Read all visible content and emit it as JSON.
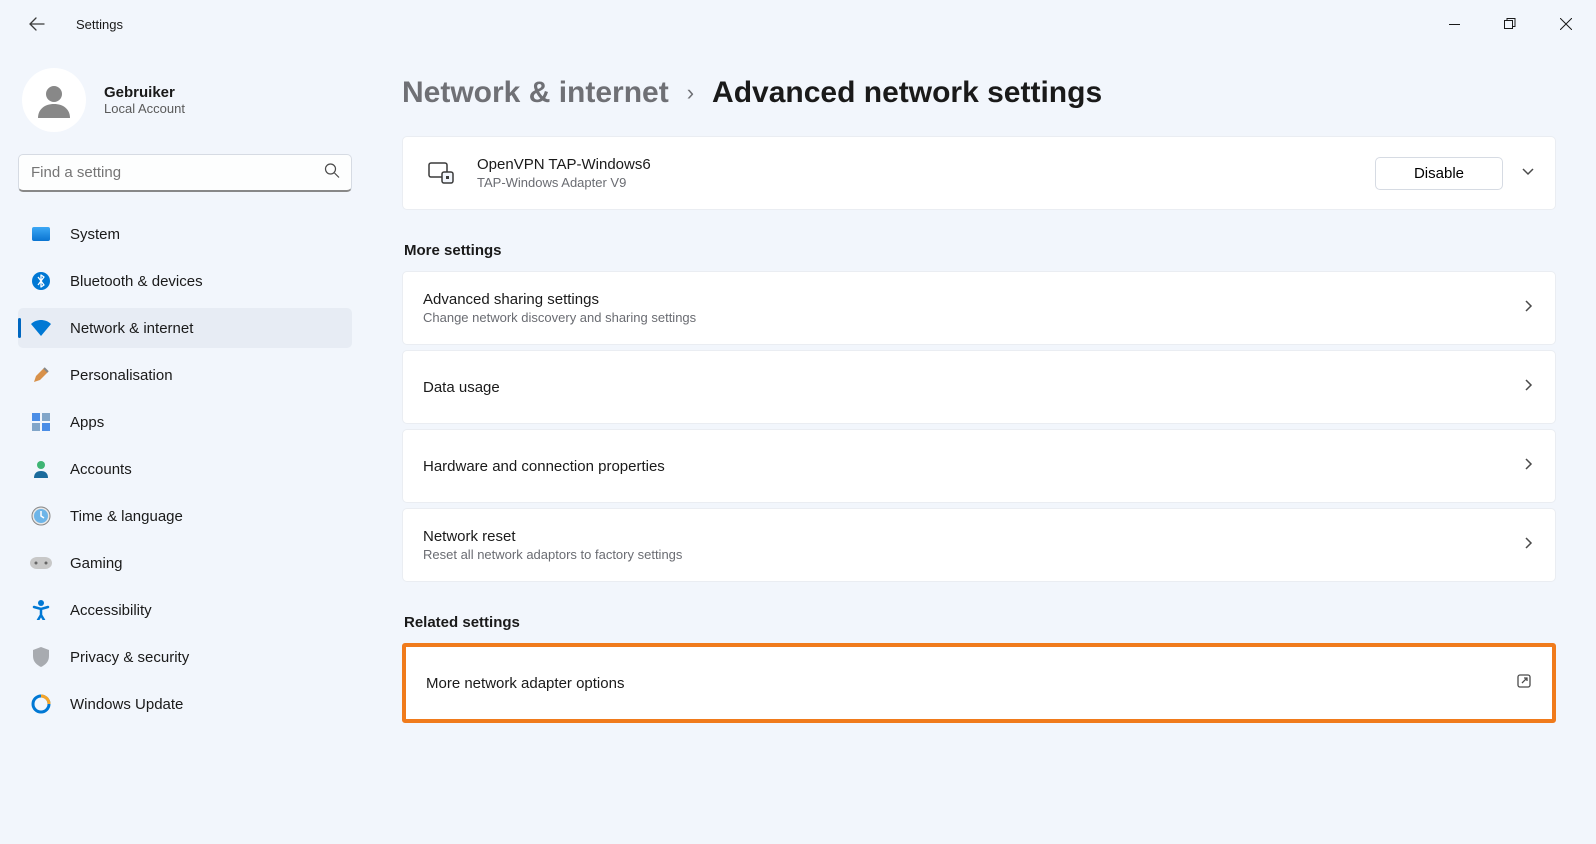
{
  "app": {
    "title": "Settings"
  },
  "user": {
    "name": "Gebruiker",
    "subtitle": "Local Account"
  },
  "search": {
    "placeholder": "Find a setting"
  },
  "nav": [
    {
      "label": "System"
    },
    {
      "label": "Bluetooth & devices"
    },
    {
      "label": "Network & internet"
    },
    {
      "label": "Personalisation"
    },
    {
      "label": "Apps"
    },
    {
      "label": "Accounts"
    },
    {
      "label": "Time & language"
    },
    {
      "label": "Gaming"
    },
    {
      "label": "Accessibility"
    },
    {
      "label": "Privacy & security"
    },
    {
      "label": "Windows Update"
    }
  ],
  "breadcrumb": {
    "parent": "Network & internet",
    "separator": "›",
    "current": "Advanced network settings"
  },
  "adapter": {
    "name": "OpenVPN TAP-Windows6",
    "desc": "TAP-Windows Adapter V9",
    "button": "Disable"
  },
  "sections": {
    "more": "More settings",
    "related": "Related settings"
  },
  "more_items": [
    {
      "title": "Advanced sharing settings",
      "sub": "Change network discovery and sharing settings"
    },
    {
      "title": "Data usage",
      "sub": ""
    },
    {
      "title": "Hardware and connection properties",
      "sub": ""
    },
    {
      "title": "Network reset",
      "sub": "Reset all network adaptors to factory settings"
    }
  ],
  "related_items": [
    {
      "title": "More network adapter options"
    }
  ]
}
